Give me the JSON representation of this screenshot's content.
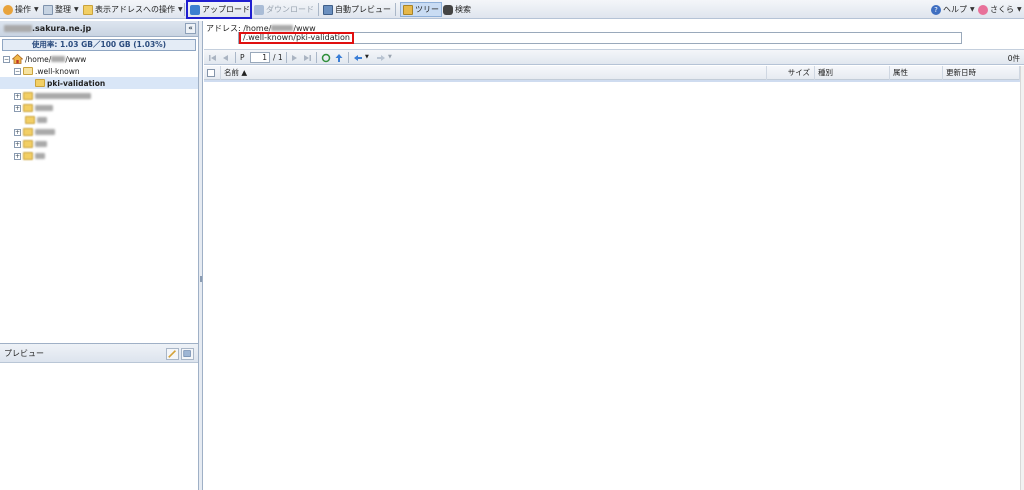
{
  "toolbar": {
    "operations": "操作",
    "organize": "整理",
    "address_ops": "表示アドレスへの操作",
    "upload": "アップロード",
    "download": "ダウンロード",
    "auto_preview": "自動プレビュー",
    "tree": "ツリー",
    "search": "検索",
    "help": "ヘルプ",
    "user": "さくら"
  },
  "sidebar": {
    "domain_suffix": ".sakura.ne.jp",
    "usage": "使用率: 1.03 GB／100 GB (1.03%)",
    "collapse": "«",
    "tree": {
      "root_prefix": "/home/",
      "root_suffix": "/www",
      "well_known": ".well-known",
      "pki": "pki-validation"
    }
  },
  "preview": {
    "title": "プレビュー"
  },
  "address": {
    "label_prefix": "アドレス: /home/",
    "label_suffix": "/www",
    "value": "/.well-known/pki-validation"
  },
  "pager": {
    "p_label": "P",
    "page": "1",
    "total": "/ 1",
    "count": "0件"
  },
  "grid": {
    "columns": [
      "名前 ▲",
      "サイズ",
      "種別",
      "属性",
      "更新日時"
    ]
  },
  "colors": {
    "highlight_blue": "#1f1fd0",
    "highlight_red": "#e01010",
    "selected_row": "#d9e6f7"
  }
}
